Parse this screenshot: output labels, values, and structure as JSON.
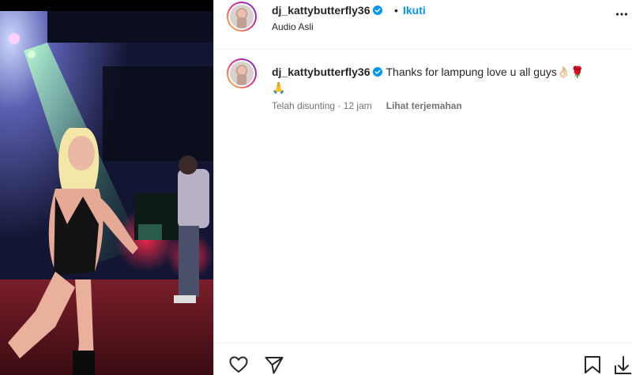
{
  "post": {
    "username": "dj_kattybutterfly36",
    "separator": "•",
    "follow_label": "Ikuti",
    "audio_label": "Audio Asli"
  },
  "comment": {
    "username": "dj_kattybutterfly36",
    "text": "Thanks for lampung love u all guys👌🏻🌹",
    "text_line2": "🙏",
    "edited_label": "Telah disunting · 12 jam",
    "translate_label": "Lihat terjemahan"
  },
  "icons": {
    "verified": "verified-badge-icon",
    "more": "more-options-icon",
    "like": "heart-icon",
    "share": "send-icon",
    "save": "bookmark-icon",
    "download": "download-icon"
  },
  "colors": {
    "follow": "#0095f6",
    "verified": "#0095f6",
    "text": "#262626",
    "muted": "#737373"
  }
}
